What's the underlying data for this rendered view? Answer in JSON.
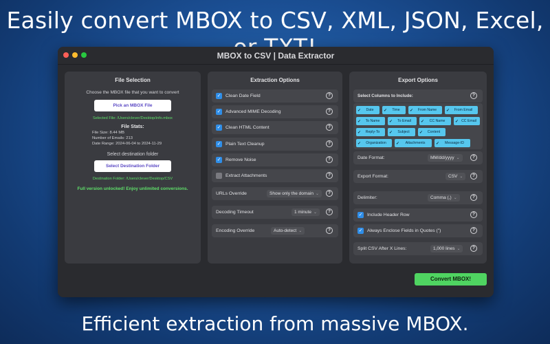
{
  "headline": "Easily convert MBOX to CSV, XML, JSON, Excel, or TXT!",
  "footline": "Efficient extraction from massive MBOX.",
  "window": {
    "title": "MBOX to CSV | Data Extractor",
    "traffic_colors": [
      "#ff5f57",
      "#febc2e",
      "#28c840"
    ]
  },
  "file_selection": {
    "title": "File Selection",
    "choose_text": "Choose the MBOX file that you want to convert",
    "pick_button": "Pick an MBOX File",
    "selected_file": "Selected File: /Users/clever/Desktop/info.mbox",
    "stats_title": "File Stats:",
    "file_size": "File Size: 8.44 MB",
    "num_emails": "Number of Emails: 213",
    "date_range": "Date Range: 2024-06-04 to 2024-11-29",
    "dest_text": "Select destination folder",
    "dest_button": "Select Destination Folder",
    "dest_folder": "Destination Folder: /Users/clever/Desktop/CSV",
    "unlocked": "Full version unlocked! Enjoy unlimited conversions."
  },
  "extraction": {
    "title": "Extraction Options",
    "checks": [
      {
        "label": "Clean Date Field",
        "checked": true
      },
      {
        "label": "Advanced MIME Decoding",
        "checked": true
      },
      {
        "label": "Clean HTML Content",
        "checked": true
      },
      {
        "label": "Plain Text Cleanup",
        "checked": true
      },
      {
        "label": "Remove Noise",
        "checked": true
      },
      {
        "label": "Extract Attachments",
        "checked": false
      }
    ],
    "urls_override": {
      "label": "URLs Override",
      "value": "Show only the domain"
    },
    "decoding_timeout": {
      "label": "Decoding Timeout",
      "value": "1 minute"
    },
    "encoding_override": {
      "label": "Encoding Override",
      "value": "Auto-detect"
    }
  },
  "export": {
    "title": "Export Options",
    "columns_label": "Select Columns to Include:",
    "columns": [
      "Date",
      "Time",
      "From Name",
      "From Email",
      "To Name",
      "To Email",
      "CC Name",
      "CC Email",
      "Reply-To",
      "Subject",
      "Content",
      "Organization",
      "Attachments",
      "Message-ID"
    ],
    "date_format": {
      "label": "Date Format:",
      "value": "MM/dd/yyyy"
    },
    "export_format": {
      "label": "Export Format:",
      "value": "CSV"
    },
    "delimiter": {
      "label": "Delimiter:",
      "value": "Comma (,)"
    },
    "include_header": "Include Header Row",
    "always_enclose": "Always Enclose Fields in Quotes (\")",
    "split": {
      "label": "Split CSV After X Lines:",
      "value": "1,000 lines"
    }
  },
  "convert_button": "Convert MBOX!",
  "colors": {
    "accent": "#2f8ee8",
    "tag": "#56c7ee",
    "green": "#4fd461"
  }
}
